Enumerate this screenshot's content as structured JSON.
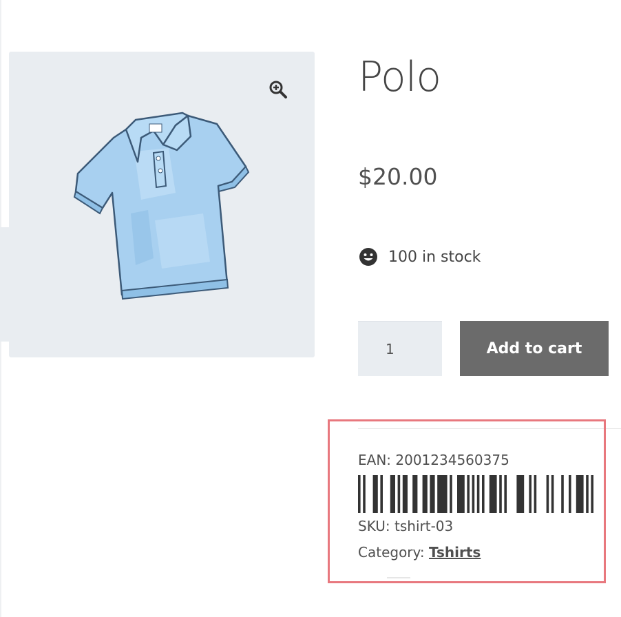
{
  "product": {
    "title": "Polo",
    "price": "$20.00",
    "stock_text": "100 in stock",
    "quantity": "1",
    "add_to_cart_label": "Add to cart"
  },
  "meta": {
    "ean_label": "EAN: ",
    "ean_value": "2001234560375",
    "sku_label": "SKU: ",
    "sku_value": "tshirt-03",
    "category_label": "Category: ",
    "category_value": "Tshirts"
  },
  "icons": {
    "zoom": "magnifier-plus-icon",
    "stock": "smiley-icon"
  },
  "colors": {
    "gallery_bg": "#e9edf1",
    "button_bg": "#6b6b6b",
    "highlight_border": "#e8787e",
    "shirt": "#a8d0f0"
  }
}
